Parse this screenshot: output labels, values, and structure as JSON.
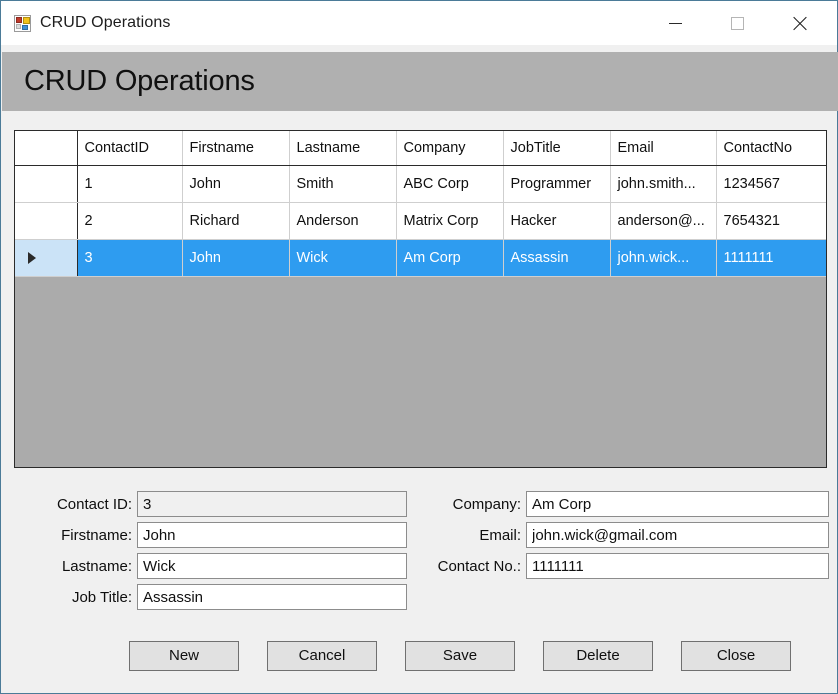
{
  "window": {
    "title": "CRUD Operations",
    "icon": "app-grid-icon",
    "border_color": "#4b7b98",
    "controls": {
      "minimize": "minimize-icon",
      "maximize": "maximize-icon",
      "close": "close-icon"
    }
  },
  "banner": {
    "title": "CRUD Operations",
    "background": "#b0b0b0"
  },
  "grid": {
    "background": "#ababab",
    "selection_color": "#2e9cf0",
    "row_header_selected_color": "#cbe3f7",
    "row_indicator": "row-selector-triangle",
    "columns": [
      "ContactID",
      "Firstname",
      "Lastname",
      "Company",
      "JobTitle",
      "Email",
      "ContactNo"
    ],
    "rows": [
      {
        "selected": false,
        "cells": [
          "1",
          "John",
          "Smith",
          "ABC Corp",
          "Programmer",
          "john.smith...",
          "1234567"
        ]
      },
      {
        "selected": false,
        "cells": [
          "2",
          "Richard",
          "Anderson",
          "Matrix Corp",
          "Hacker",
          "anderson@...",
          "7654321"
        ]
      },
      {
        "selected": true,
        "cells": [
          "3",
          "John",
          "Wick",
          "Am Corp",
          "Assassin",
          "john.wick...",
          "1111111"
        ]
      }
    ]
  },
  "form": {
    "left": [
      {
        "label": "Contact ID:",
        "value": "3",
        "readonly": true
      },
      {
        "label": "Firstname:",
        "value": "John",
        "readonly": false
      },
      {
        "label": "Lastname:",
        "value": "Wick",
        "readonly": false
      },
      {
        "label": "Job Title:",
        "value": "Assassin",
        "readonly": false
      }
    ],
    "right": [
      {
        "label": "Company:",
        "value": "Am Corp",
        "readonly": false
      },
      {
        "label": "Email:",
        "value": "john.wick@gmail.com",
        "readonly": false
      },
      {
        "label": "Contact No.:",
        "value": "1111111",
        "readonly": false
      }
    ]
  },
  "buttons": [
    {
      "label": "New"
    },
    {
      "label": "Cancel"
    },
    {
      "label": "Save"
    },
    {
      "label": "Delete"
    },
    {
      "label": "Close"
    }
  ]
}
